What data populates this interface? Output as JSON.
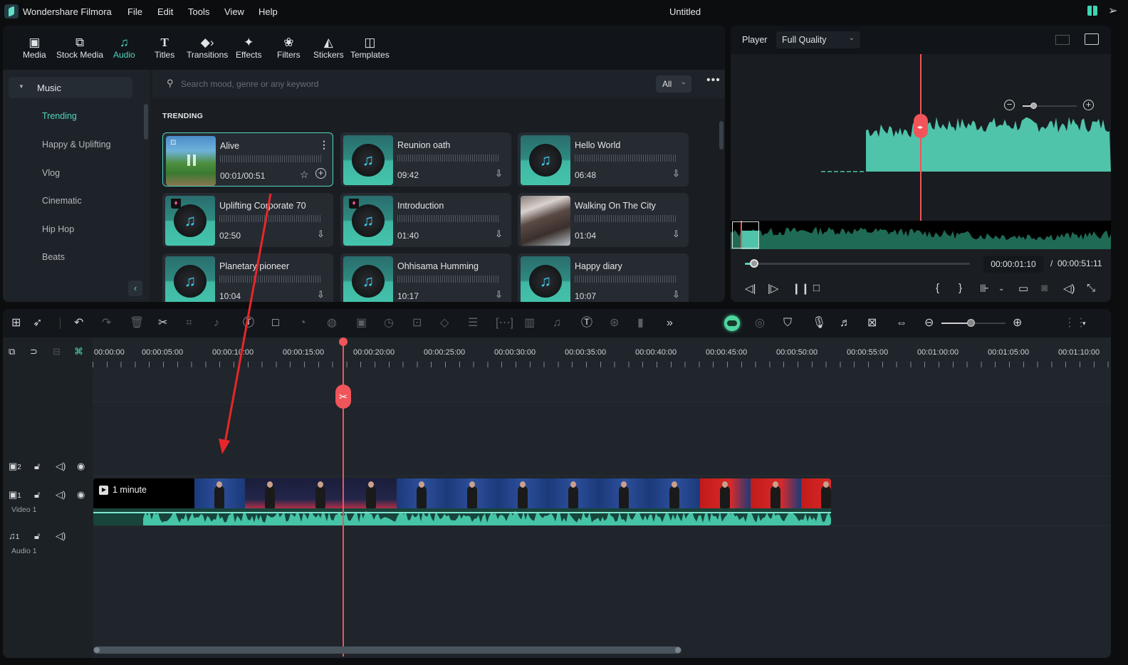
{
  "app": {
    "name": "Wondershare Filmora",
    "window_title": "Untitled",
    "menu": [
      "File",
      "Edit",
      "Tools",
      "View",
      "Help"
    ],
    "top_icons": [
      "gift-icon",
      "send-feedback-icon"
    ]
  },
  "library": {
    "tabs": [
      {
        "label": "Media",
        "icon": "media-icon",
        "active": false
      },
      {
        "label": "Stock Media",
        "icon": "stock-media-icon",
        "active": false
      },
      {
        "label": "Audio",
        "icon": "music-note-icon",
        "active": true
      },
      {
        "label": "Titles",
        "icon": "titles-icon",
        "active": false
      },
      {
        "label": "Transitions",
        "icon": "transitions-icon",
        "active": false
      },
      {
        "label": "Effects",
        "icon": "effects-icon",
        "active": false
      },
      {
        "label": "Filters",
        "icon": "filters-icon",
        "active": false
      },
      {
        "label": "Stickers",
        "icon": "stickers-icon",
        "active": false
      },
      {
        "label": "Templates",
        "icon": "templates-icon",
        "active": false
      }
    ],
    "sidebar": {
      "group_label": "Music",
      "categories": [
        {
          "label": "Trending",
          "active": true
        },
        {
          "label": "Happy & Uplifting",
          "active": false
        },
        {
          "label": "Vlog",
          "active": false
        },
        {
          "label": "Cinematic",
          "active": false
        },
        {
          "label": "Hip Hop",
          "active": false
        },
        {
          "label": "Beats",
          "active": false
        }
      ]
    },
    "search": {
      "placeholder": "Search mood, genre or any keyword",
      "value": "",
      "filter_selected": "All"
    },
    "section_title": "TRENDING",
    "tracks": [
      {
        "title": "Alive",
        "time": "00:01/00:51",
        "thumb": "nature",
        "selected": true,
        "playing": true,
        "premium": false
      },
      {
        "title": "Reunion oath",
        "time": "09:42",
        "thumb": "disc",
        "selected": false,
        "premium": false
      },
      {
        "title": "Hello World",
        "time": "06:48",
        "thumb": "disc",
        "selected": false,
        "premium": false
      },
      {
        "title": "Uplifting Corporate 70",
        "time": "02:50",
        "thumb": "disc",
        "selected": false,
        "premium": true
      },
      {
        "title": "Introduction",
        "time": "01:40",
        "thumb": "disc",
        "selected": false,
        "premium": true
      },
      {
        "title": "Walking On The City",
        "time": "01:04",
        "thumb": "rocks",
        "selected": false,
        "premium": false
      },
      {
        "title": "Planetary pioneer",
        "time": "10:04",
        "thumb": "disc",
        "selected": false,
        "premium": false
      },
      {
        "title": "Ohhisama Humming",
        "time": "10:17",
        "thumb": "disc",
        "selected": false,
        "premium": false
      },
      {
        "title": "Happy diary",
        "time": "10:07",
        "thumb": "disc",
        "selected": false,
        "premium": false
      }
    ]
  },
  "player": {
    "label": "Player",
    "quality": "Full Quality",
    "current_time": "00:00:01:10",
    "total_time": "/  00:00:51:11",
    "progress_fraction": 0.03,
    "waveform_zoom_fraction": 0.2
  },
  "timeline": {
    "zoom_fraction": 0.45,
    "ruler_labels": [
      "00:00:00",
      "00:00:05:00",
      "00:00:10:00",
      "00:00:15:00",
      "00:00:20:00",
      "00:00:25:00",
      "00:00:30:00",
      "00:00:35:00",
      "00:00:40:00",
      "00:00:45:00",
      "00:00:50:00",
      "00:00:55:00",
      "00:01:00:00",
      "00:01:05:00",
      "00:01:10:00"
    ],
    "tracks": [
      {
        "id": "2",
        "type": "video",
        "label": ""
      },
      {
        "id": "1",
        "type": "video",
        "label": "Video 1"
      },
      {
        "id": "1",
        "type": "audio",
        "label": "Audio 1"
      }
    ],
    "clip": {
      "name": "1 minute"
    }
  }
}
